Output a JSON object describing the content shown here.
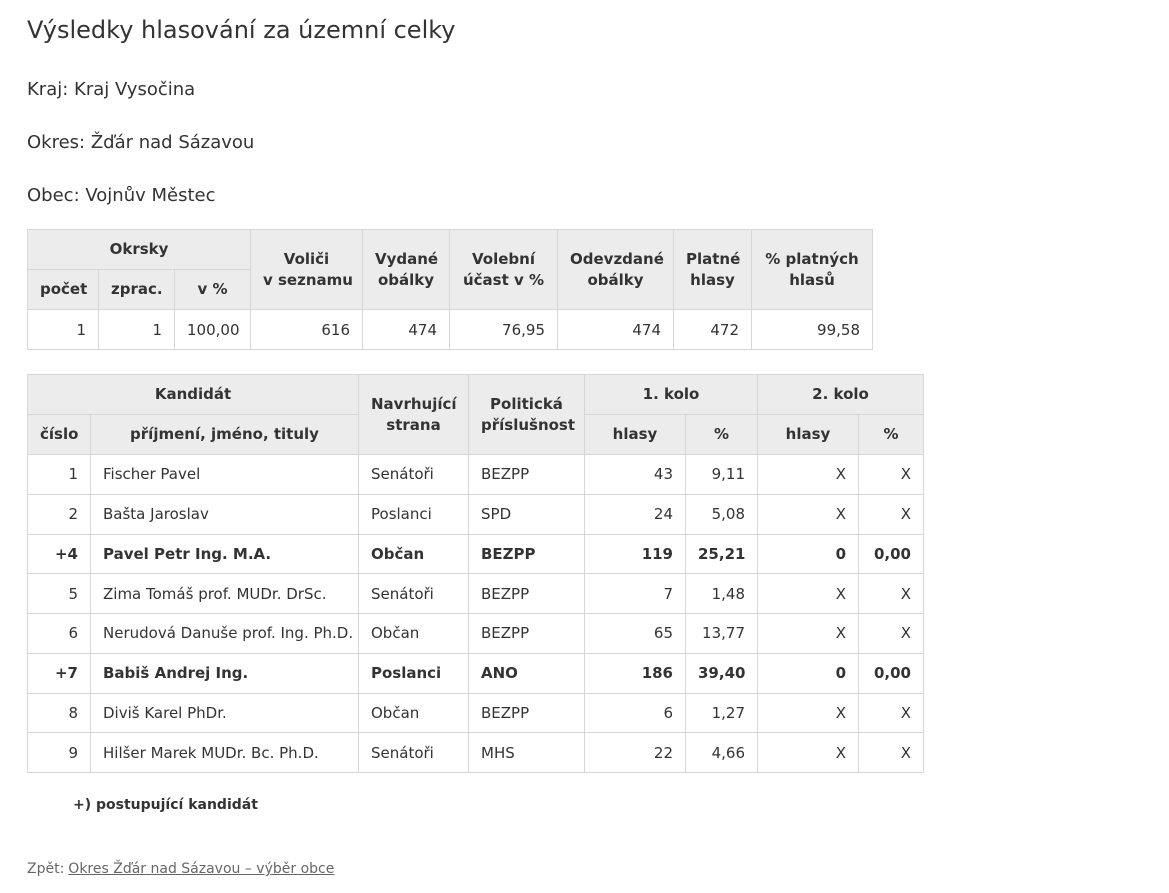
{
  "page": {
    "title": "Výsledky hlasování za územní celky",
    "kraj": "Kraj: Kraj Vysočina",
    "okres": "Okres: Žďár nad Sázavou",
    "obec": "Obec: Vojnův Městec"
  },
  "summary": {
    "headers": {
      "okrsky": "Okrsky",
      "pocet": "počet",
      "zprac": "zprac.",
      "vpct": "v %",
      "volici_1": "Voliči",
      "volici_2": "v seznamu",
      "vydane_1": "Vydané",
      "vydane_2": "obálky",
      "ucast_1": "Volební",
      "ucast_2": "účast v %",
      "odevzdane_1": "Odevzdané",
      "odevzdane_2": "obálky",
      "platne_1": "Platné",
      "platne_2": "hlasy",
      "pct_platnych_1": "% platných",
      "pct_platnych_2": "hlasů"
    },
    "row": {
      "pocet": "1",
      "zprac": "1",
      "vpct": "100,00",
      "volici": "616",
      "vydane": "474",
      "ucast": "76,95",
      "odevzdane": "474",
      "platne": "472",
      "pct_platnych": "99,58"
    }
  },
  "candidates": {
    "headers": {
      "kandidat": "Kandidát",
      "cislo": "číslo",
      "jmeno": "příjmení, jméno, tituly",
      "strana_1": "Navrhující",
      "strana_2": "strana",
      "prislusnost_1": "Politická",
      "prislusnost_2": "příslušnost",
      "kolo1": "1. kolo",
      "kolo2": "2. kolo",
      "hlasy1": "hlasy",
      "pct1": "%",
      "hlasy2": "hlasy",
      "pct2": "%"
    },
    "rows": [
      {
        "cislo": "1",
        "jmeno": "Fischer Pavel",
        "strana": "Senátoři",
        "prislusnost": "BEZPP",
        "hlasy1": "43",
        "pct1": "9,11",
        "hlasy2": "X",
        "pct2": "X"
      },
      {
        "cislo": "2",
        "jmeno": "Bašta Jaroslav",
        "strana": "Poslanci",
        "prislusnost": "SPD",
        "hlasy1": "24",
        "pct1": "5,08",
        "hlasy2": "X",
        "pct2": "X"
      },
      {
        "cislo": "+4",
        "jmeno": "Pavel Petr Ing. M.A.",
        "strana": "Občan",
        "prislusnost": "BEZPP",
        "hlasy1": "119",
        "pct1": "25,21",
        "hlasy2": "0",
        "pct2": "0,00"
      },
      {
        "cislo": "5",
        "jmeno": "Zima Tomáš prof. MUDr. DrSc.",
        "strana": "Senátoři",
        "prislusnost": "BEZPP",
        "hlasy1": "7",
        "pct1": "1,48",
        "hlasy2": "X",
        "pct2": "X"
      },
      {
        "cislo": "6",
        "jmeno": "Nerudová Danuše prof. Ing. Ph.D.",
        "strana": "Občan",
        "prislusnost": "BEZPP",
        "hlasy1": "65",
        "pct1": "13,77",
        "hlasy2": "X",
        "pct2": "X"
      },
      {
        "cislo": "+7",
        "jmeno": "Babiš Andrej Ing.",
        "strana": "Poslanci",
        "prislusnost": "ANO",
        "hlasy1": "186",
        "pct1": "39,40",
        "hlasy2": "0",
        "pct2": "0,00"
      },
      {
        "cislo": "8",
        "jmeno": "Diviš Karel PhDr.",
        "strana": "Občan",
        "prislusnost": "BEZPP",
        "hlasy1": "6",
        "pct1": "1,27",
        "hlasy2": "X",
        "pct2": "X"
      },
      {
        "cislo": "9",
        "jmeno": "Hilšer Marek MUDr. Bc. Ph.D.",
        "strana": "Senátoři",
        "prislusnost": "MHS",
        "hlasy1": "22",
        "pct1": "4,66",
        "hlasy2": "X",
        "pct2": "X"
      }
    ]
  },
  "footer": {
    "note": "+) postupující kandidát",
    "back_label": "Zpět:",
    "back_link": "Okres Žďár nad Sázavou – výběr obce"
  }
}
